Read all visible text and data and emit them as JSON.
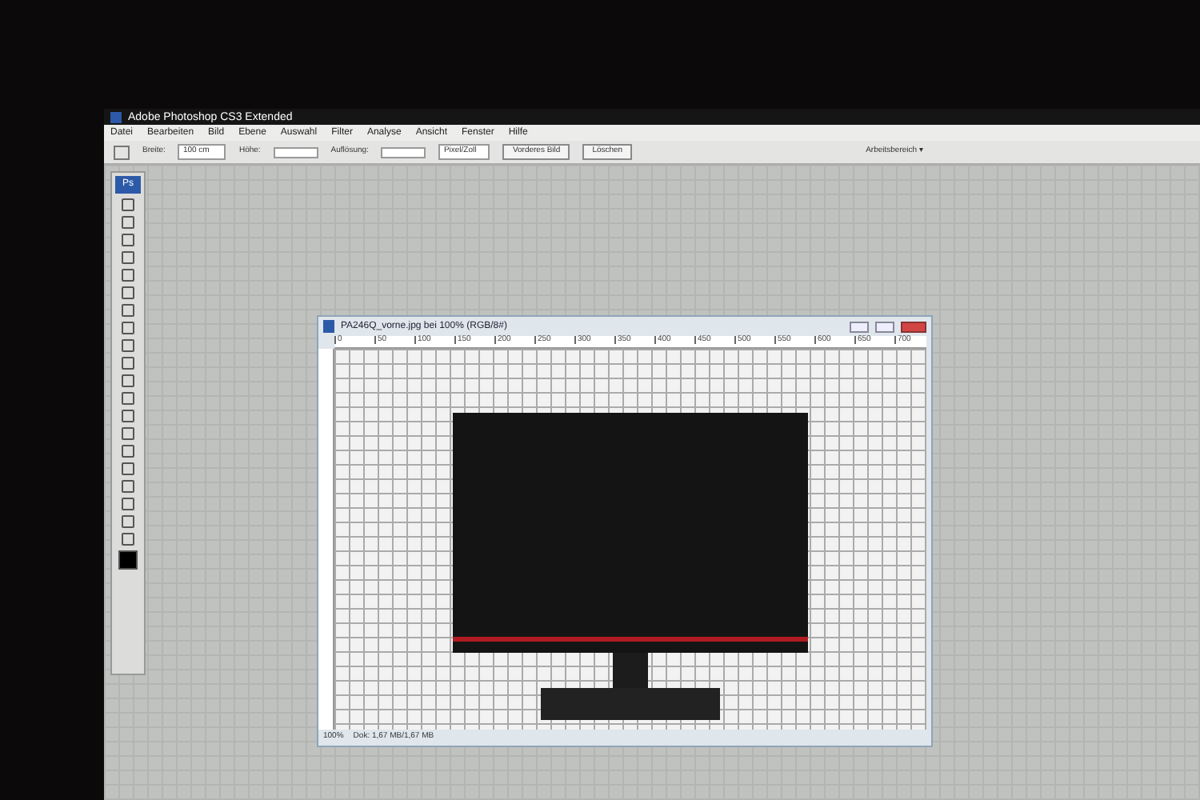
{
  "app": {
    "title": "Adobe Photoshop CS3 Extended",
    "menu": [
      "Datei",
      "Bearbeiten",
      "Bild",
      "Ebene",
      "Auswahl",
      "Filter",
      "Analyse",
      "Ansicht",
      "Fenster",
      "Hilfe"
    ],
    "options": {
      "width_label": "Breite:",
      "width_value": "100 cm",
      "height_label": "Höhe:",
      "resolution_label": "Auflösung:",
      "unit": "Pixel/Zoll",
      "buttons": [
        "Vorderes Bild",
        "Löschen"
      ],
      "workspace": "Arbeitsbereich ▾"
    }
  },
  "toolbox": {
    "logo": "Ps"
  },
  "document": {
    "title": "PA246Q_vorne.jpg bei 100% (RGB/8#)",
    "ruler_ticks": [
      "0",
      "50",
      "100",
      "150",
      "200",
      "250",
      "300",
      "350",
      "400",
      "450",
      "500",
      "550",
      "600",
      "650",
      "700"
    ],
    "zoom": "100%",
    "doc_size": "Dok: 1,67 MB/1,67 MB"
  }
}
